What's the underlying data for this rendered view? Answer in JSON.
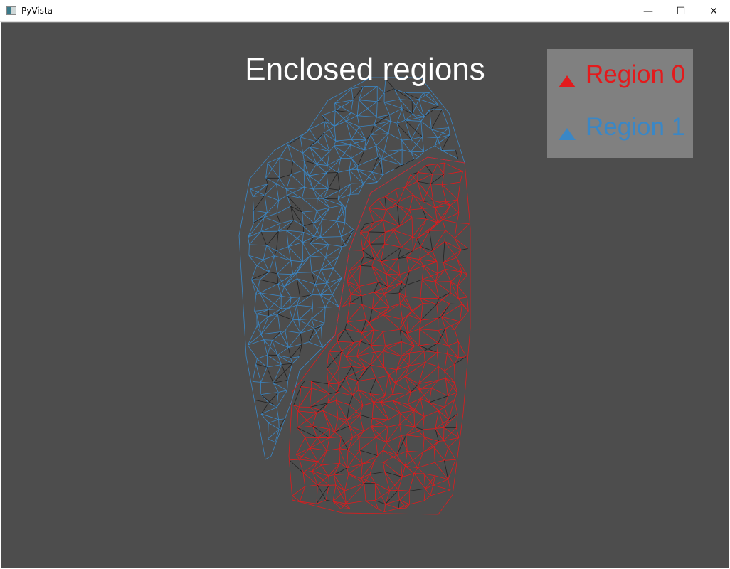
{
  "window": {
    "title": "PyVista",
    "minimize": "—",
    "maximize": "☐",
    "close": "✕"
  },
  "plot": {
    "title": "Enclosed regions",
    "background": "#4d4d4d"
  },
  "legend": {
    "background": "#808080",
    "entries": [
      {
        "label": "Region 0",
        "color": "#e31a1c",
        "icon": "triangle-icon"
      },
      {
        "label": "Region 1",
        "color": "#3a87c6",
        "icon": "triangle-icon"
      }
    ]
  },
  "mesh": {
    "style": "wireframe",
    "regions": [
      {
        "color": "#e31a1c"
      },
      {
        "color": "#3a87c6"
      }
    ]
  }
}
